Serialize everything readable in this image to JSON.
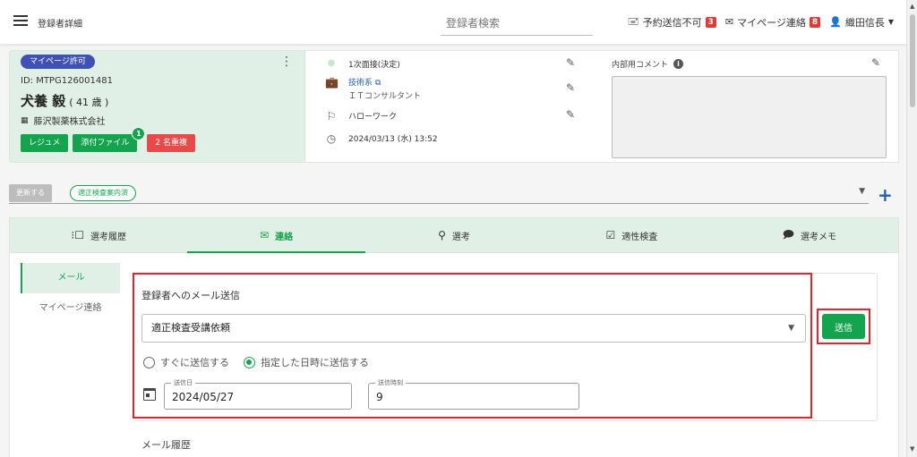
{
  "header": {
    "page_title": "登録者詳細",
    "search_placeholder": "登録者検索",
    "send_unavailable_label": "予約送信不可",
    "send_unavailable_count": "3",
    "mypage_contact_label": "マイページ連絡",
    "mypage_contact_count": "8",
    "user_name": "織田信長"
  },
  "profile": {
    "mypage_badge": "マイページ許可",
    "id_text": "ID: MTPG126001481",
    "name": "犬養 毅",
    "age": "( 41 歳 )",
    "company": "藤沢製薬株式会社",
    "resume_button": "レジュメ",
    "attach_button": "添付ファイル",
    "attach_count": "1",
    "duplicate_button": "2 名重複"
  },
  "info": {
    "stage": "1次面接(決定)",
    "job_category": "技術系",
    "job_title": "ＩＴコンサルタント",
    "source": "ハローワーク",
    "datetime": "2024/03/13 (水) 13:52",
    "comment_label": "内部用コメント",
    "comment_value": ""
  },
  "status": {
    "update_button": "更新する",
    "chip": "適正検査案内済"
  },
  "tabs": [
    {
      "label": "選考履歴",
      "icon": "history-icon"
    },
    {
      "label": "連絡",
      "icon": "mail-icon"
    },
    {
      "label": "選考",
      "icon": "person-check-icon"
    },
    {
      "label": "適性検査",
      "icon": "checkbox-icon"
    },
    {
      "label": "選考メモ",
      "icon": "memo-icon"
    }
  ],
  "side_nav": [
    "メール",
    "マイページ連絡"
  ],
  "mail": {
    "heading": "登録者へのメール送信",
    "template_value": "適正検査受講依頼",
    "send_button": "送信",
    "radio_now": "すぐに送信する",
    "radio_scheduled": "指定した日時に送信する",
    "date_label": "送信日",
    "date_value": "2024/05/27",
    "time_label": "送信時刻",
    "time_value": "9",
    "history_label": "メール履歴"
  },
  "colors": {
    "accent_green": "#14a44d",
    "badge_blue": "#3f51b5",
    "alert_red": "#e53935",
    "highlight_red": "#e3242b"
  }
}
